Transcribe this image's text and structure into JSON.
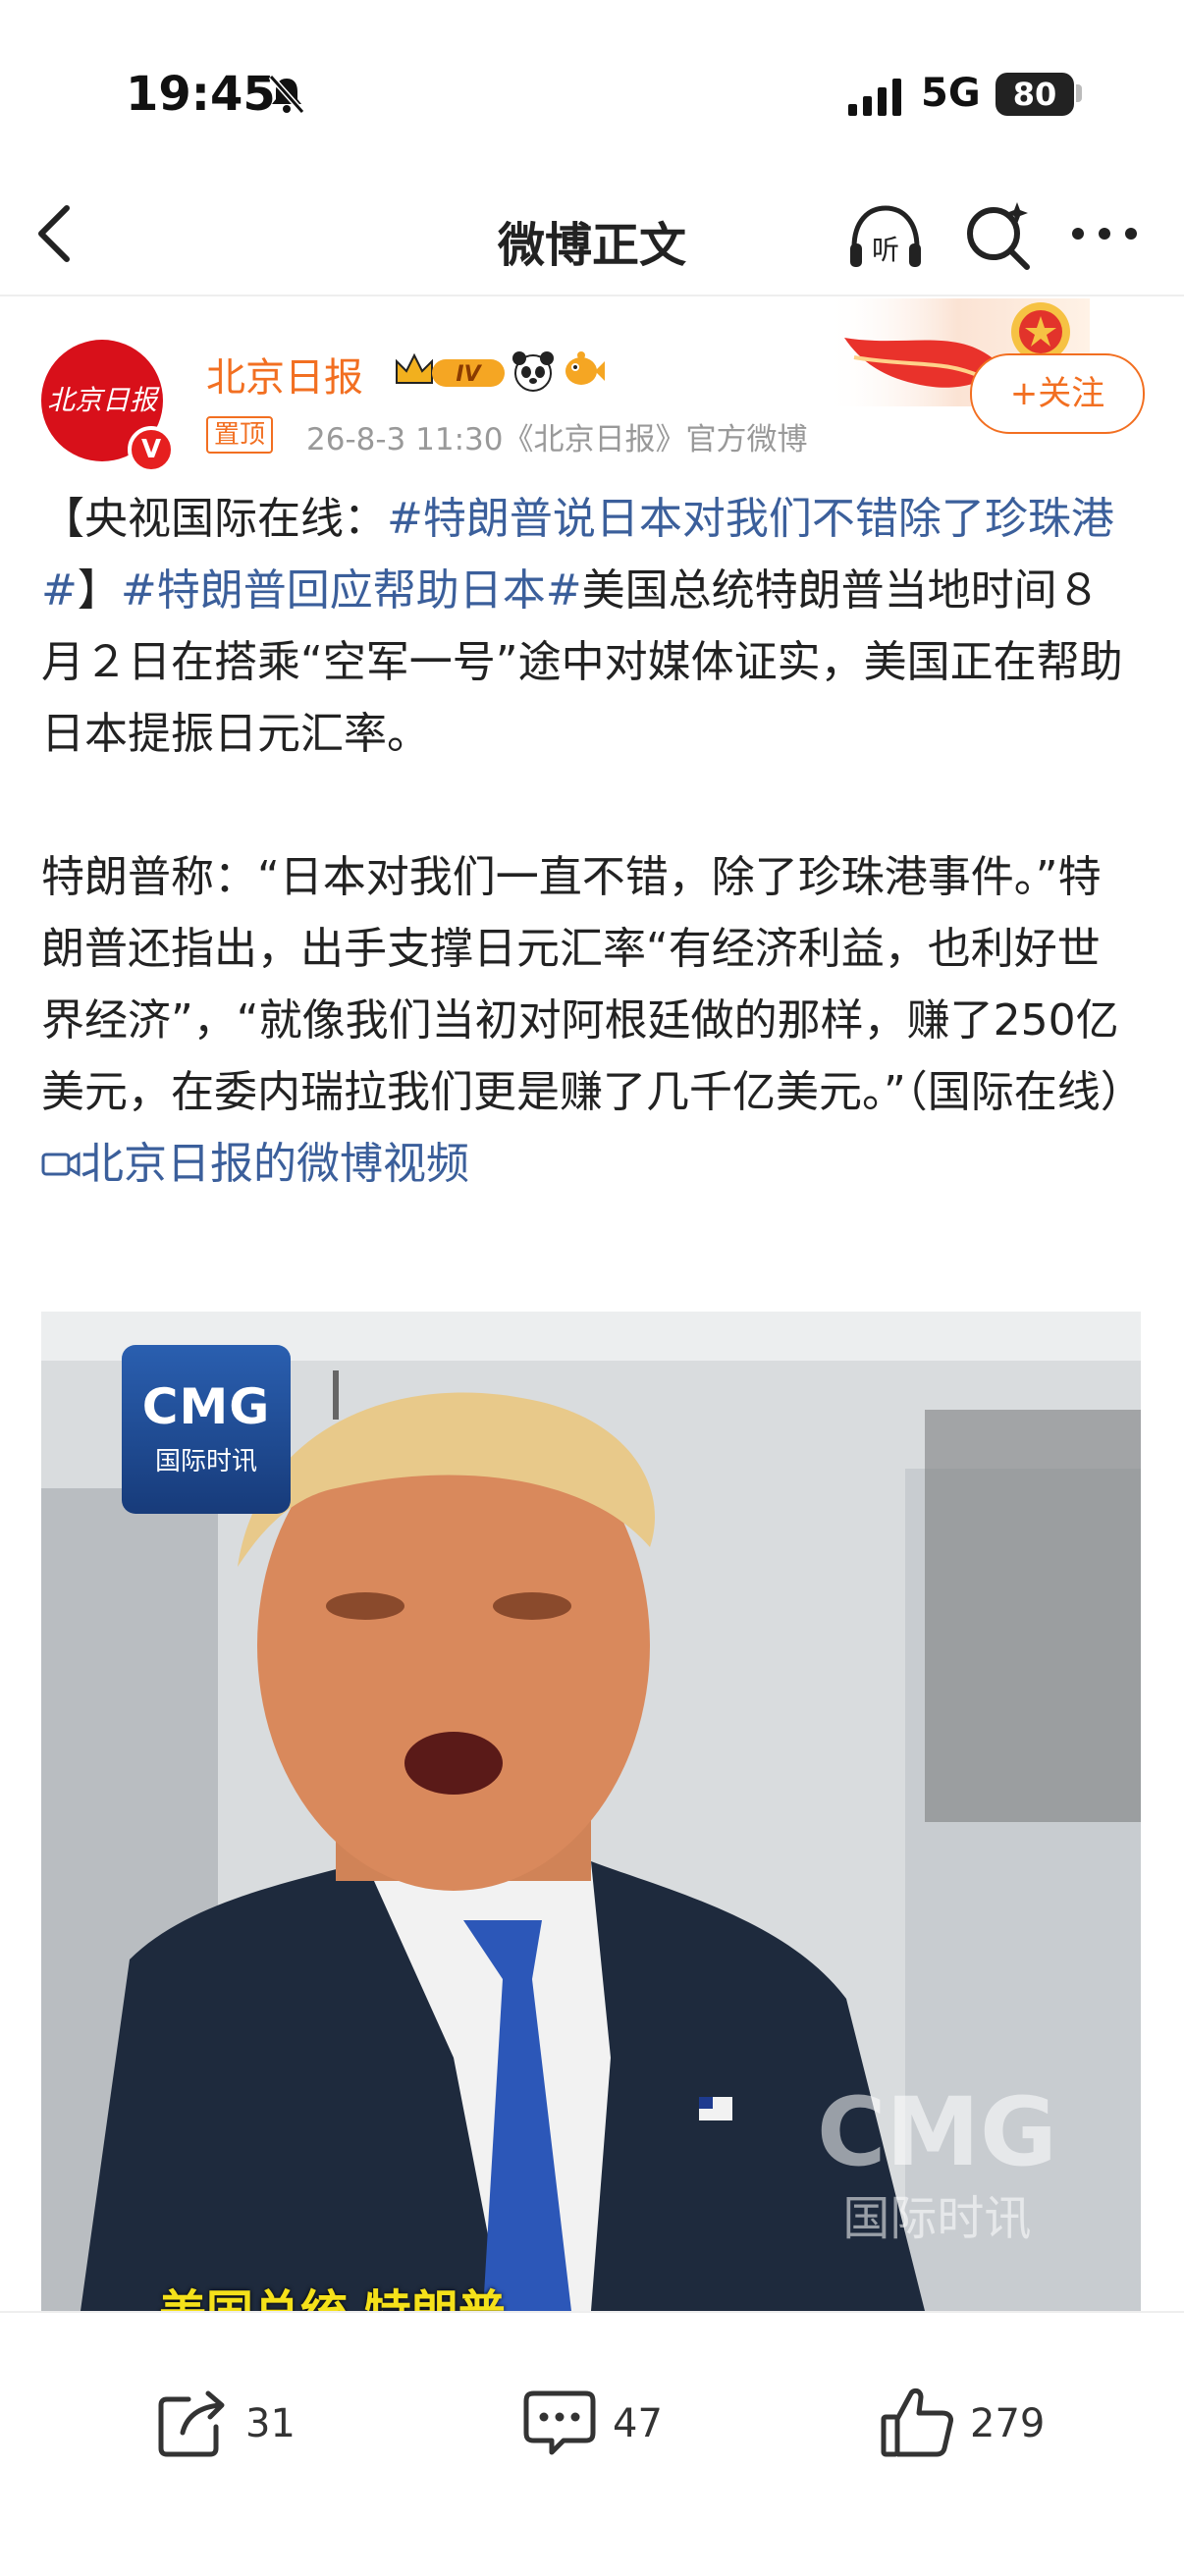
{
  "status_bar": {
    "time": "19:45",
    "network": "5G",
    "battery": "80"
  },
  "nav": {
    "title": "微博正文"
  },
  "post": {
    "avatar_text": "北京日报",
    "verified_mark": "V",
    "author": "北京日报",
    "level_badge": "IV",
    "pinned_label": "置顶",
    "meta": "26-8-3 11:30《北京日报》官方微博",
    "follow_label": "+关注",
    "body": {
      "p1_open": "【央视国际在线：",
      "p1_tag1": "#特朗普说日本对我们不错除了珍珠港#",
      "p1_close": "】",
      "p1_tag2": "#特朗普回应帮助日本#",
      "p1_rest": "美国总统特朗普当地时间８月２日在搭乘“空军一号”途中对媒体证实，美国正在帮助日本提振日元汇率。",
      "p2_text": "特朗普称：“日本对我们一直不错，除了珍珠港事件。”特朗普还指出，出手支撑日元汇率“有经济利益，也利好世界经济”，“就像我们当初对阿根廷做的那样，赚了250亿美元，在委内瑞拉我们更是赚了几千亿美元。”（国际在线）",
      "video_link": "北京日报的微博视频"
    },
    "video": {
      "logo_big": "CMG",
      "logo_small": "国际时讯",
      "watermark_big": "CMG",
      "watermark_small": "国际时讯",
      "subtitle": "美国总统 特朗普"
    }
  },
  "actions": {
    "reposts": "31",
    "comments": "47",
    "likes": "279"
  },
  "colors": {
    "accent_orange": "#f26f21",
    "link_blue": "#3b5f9b",
    "brand_red": "#d8101a"
  }
}
